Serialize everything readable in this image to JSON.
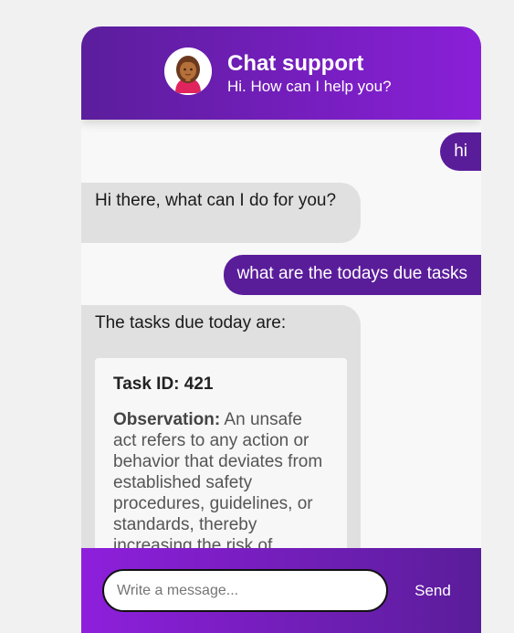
{
  "header": {
    "title": "Chat support",
    "subtitle": "Hi. How can I help you?",
    "avatar_icon": "woman-avatar-icon"
  },
  "messages": [
    {
      "sender": "user",
      "text": "hi"
    },
    {
      "sender": "bot",
      "text": "Hi there, what can I do for you?"
    },
    {
      "sender": "user",
      "text": "what are the todays due tasks"
    },
    {
      "sender": "bot",
      "text": "The tasks due today are:"
    }
  ],
  "task_card": {
    "id_label": "Task ID: 421",
    "observation_label": "Observation:",
    "observation_text": " An unsafe act refers to any action or behavior that deviates from established safety procedures, guidelines, or standards, thereby increasing the risk of"
  },
  "footer": {
    "input_placeholder": "Write a message...",
    "input_value": "",
    "send_label": "Send"
  },
  "colors": {
    "header_gradient_start": "#5b1e9c",
    "header_gradient_end": "#8a1fd8",
    "user_bubble": "#5a1d9a",
    "bot_bubble": "#e0e0e0"
  }
}
